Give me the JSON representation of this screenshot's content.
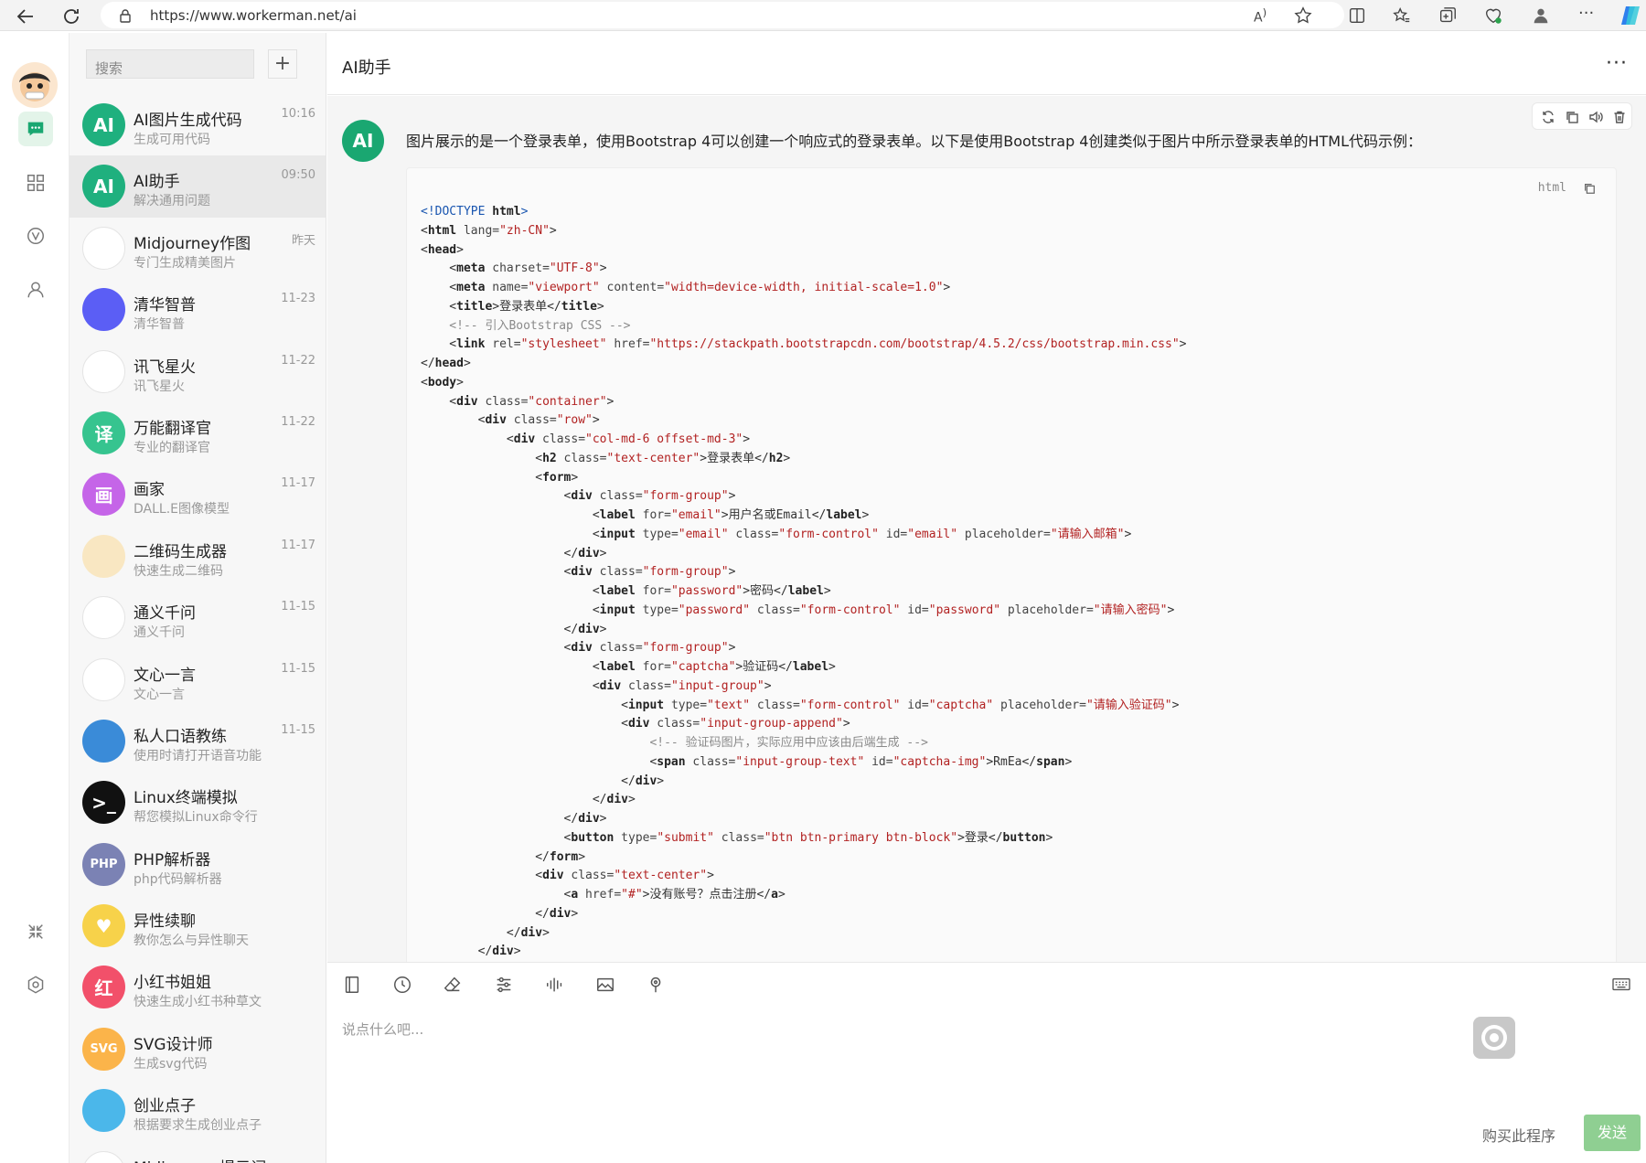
{
  "browser": {
    "url": "https://www.workerman.net/ai"
  },
  "sidebar": {
    "search_placeholder": "搜索",
    "add_label": "+",
    "items": [
      {
        "name": "AI图片生成代码",
        "desc": "生成可用代码",
        "time": "10:16",
        "icon": "AI",
        "color": "#1fb07e"
      },
      {
        "name": "AI助手",
        "desc": "解决通用问题",
        "time": "09:50",
        "icon": "AI",
        "color": "#1fb07e"
      },
      {
        "name": "Midjourney作图",
        "desc": "专门生成精美图片",
        "time": "昨天",
        "icon": "",
        "color": "#ffffff"
      },
      {
        "name": "清华智普",
        "desc": "清华智普",
        "time": "11-23",
        "icon": "",
        "color": "#5b5ef5"
      },
      {
        "name": "讯飞星火",
        "desc": "讯飞星火",
        "time": "11-22",
        "icon": "",
        "color": "#ffffff"
      },
      {
        "name": "万能翻译官",
        "desc": "专业的翻译官",
        "time": "11-22",
        "icon": "译",
        "color": "#36c48f"
      },
      {
        "name": "画家",
        "desc": "DALL.E图像模型",
        "time": "11-17",
        "icon": "画",
        "color": "#c565e8"
      },
      {
        "name": "二维码生成器",
        "desc": "快速生成二维码",
        "time": "11-17",
        "icon": "",
        "color": "#f9e7c2"
      },
      {
        "name": "通义千问",
        "desc": "通义千问",
        "time": "11-15",
        "icon": "",
        "color": "#ffffff"
      },
      {
        "name": "文心一言",
        "desc": "文心一言",
        "time": "11-15",
        "icon": "",
        "color": "#ffffff"
      },
      {
        "name": "私人口语教练",
        "desc": "使用时请打开语音功能",
        "time": "11-15",
        "icon": "",
        "color": "#3a8bd8"
      },
      {
        "name": "Linux终端模拟",
        "desc": "帮您模拟Linux命令行",
        "time": "",
        "icon": ">_",
        "color": "#111111"
      },
      {
        "name": "PHP解析器",
        "desc": "php代码解析器",
        "time": "",
        "icon": "PHP",
        "color": "#7b82b4"
      },
      {
        "name": "异性续聊",
        "desc": "教你怎么与异性聊天",
        "time": "",
        "icon": "♥",
        "color": "#f7d24a"
      },
      {
        "name": "小红书姐姐",
        "desc": "快速生成小红书种草文",
        "time": "",
        "icon": "红",
        "color": "#f2506a"
      },
      {
        "name": "SVG设计师",
        "desc": "生成svg代码",
        "time": "",
        "icon": "SVG",
        "color": "#fbb44a"
      },
      {
        "name": "创业点子",
        "desc": "根据要求生成创业点子",
        "time": "",
        "icon": "",
        "color": "#4bb7ea"
      },
      {
        "name": "Midjourney提示词",
        "desc": "",
        "time": "",
        "icon": "",
        "color": "#ffffff"
      }
    ]
  },
  "chat": {
    "title": "AI助手",
    "avatar_label": "AI",
    "message": "图片展示的是一个登录表单，使用Bootstrap 4可以创建一个响应式的登录表单。以下是使用Bootstrap 4创建类似于图片中所示登录表单的HTML代码示例：",
    "code_lang": "html",
    "code_lines": [
      [
        [
          "dt",
          "<!DOCTYPE "
        ],
        [
          "tn",
          "html"
        ],
        [
          "dt",
          ">"
        ]
      ],
      [
        [
          "t",
          "<"
        ],
        [
          "tn",
          "html"
        ],
        [
          "at",
          " lang="
        ],
        [
          "sv",
          "\"zh-CN\""
        ],
        [
          "t",
          ">"
        ]
      ],
      [
        [
          "t",
          "<"
        ],
        [
          "tn",
          "head"
        ],
        [
          "t",
          ">"
        ]
      ],
      [
        [
          "t",
          "    <"
        ],
        [
          "tn",
          "meta"
        ],
        [
          "at",
          " charset="
        ],
        [
          "sv",
          "\"UTF-8\""
        ],
        [
          "t",
          ">"
        ]
      ],
      [
        [
          "t",
          "    <"
        ],
        [
          "tn",
          "meta"
        ],
        [
          "at",
          " name="
        ],
        [
          "sv",
          "\"viewport\""
        ],
        [
          "at",
          " content="
        ],
        [
          "sv",
          "\"width=device-width, initial-scale=1.0\""
        ],
        [
          "t",
          ">"
        ]
      ],
      [
        [
          "t",
          "    <"
        ],
        [
          "tn",
          "title"
        ],
        [
          "t",
          ">登录表单</"
        ],
        [
          "tn",
          "title"
        ],
        [
          "t",
          ">"
        ]
      ],
      [
        [
          "cm",
          "    <!-- 引入Bootstrap CSS -->"
        ]
      ],
      [
        [
          "t",
          "    <"
        ],
        [
          "tn",
          "link"
        ],
        [
          "at",
          " rel="
        ],
        [
          "sv",
          "\"stylesheet\""
        ],
        [
          "at",
          " href="
        ],
        [
          "sv",
          "\"https://stackpath.bootstrapcdn.com/bootstrap/4.5.2/css/bootstrap.min.css\""
        ],
        [
          "t",
          ">"
        ]
      ],
      [
        [
          "t",
          "</"
        ],
        [
          "tn",
          "head"
        ],
        [
          "t",
          ">"
        ]
      ],
      [
        [
          "t",
          "<"
        ],
        [
          "tn",
          "body"
        ],
        [
          "t",
          ">"
        ]
      ],
      [
        [
          "t",
          "    <"
        ],
        [
          "tn",
          "div"
        ],
        [
          "at",
          " class="
        ],
        [
          "sv",
          "\"container\""
        ],
        [
          "t",
          ">"
        ]
      ],
      [
        [
          "t",
          "        <"
        ],
        [
          "tn",
          "div"
        ],
        [
          "at",
          " class="
        ],
        [
          "sv",
          "\"row\""
        ],
        [
          "t",
          ">"
        ]
      ],
      [
        [
          "t",
          "            <"
        ],
        [
          "tn",
          "div"
        ],
        [
          "at",
          " class="
        ],
        [
          "sv",
          "\"col-md-6 offset-md-3\""
        ],
        [
          "t",
          ">"
        ]
      ],
      [
        [
          "t",
          "                <"
        ],
        [
          "tn",
          "h2"
        ],
        [
          "at",
          " class="
        ],
        [
          "sv",
          "\"text-center\""
        ],
        [
          "t",
          ">登录表单</"
        ],
        [
          "tn",
          "h2"
        ],
        [
          "t",
          ">"
        ]
      ],
      [
        [
          "t",
          "                <"
        ],
        [
          "tn",
          "form"
        ],
        [
          "t",
          ">"
        ]
      ],
      [
        [
          "t",
          "                    <"
        ],
        [
          "tn",
          "div"
        ],
        [
          "at",
          " class="
        ],
        [
          "sv",
          "\"form-group\""
        ],
        [
          "t",
          ">"
        ]
      ],
      [
        [
          "t",
          "                        <"
        ],
        [
          "tn",
          "label"
        ],
        [
          "at",
          " for="
        ],
        [
          "sv",
          "\"email\""
        ],
        [
          "t",
          ">用户名或Email</"
        ],
        [
          "tn",
          "label"
        ],
        [
          "t",
          ">"
        ]
      ],
      [
        [
          "t",
          "                        <"
        ],
        [
          "tn",
          "input"
        ],
        [
          "at",
          " type="
        ],
        [
          "sv",
          "\"email\""
        ],
        [
          "at",
          " class="
        ],
        [
          "sv",
          "\"form-control\""
        ],
        [
          "at",
          " id="
        ],
        [
          "sv",
          "\"email\""
        ],
        [
          "at",
          " placeholder="
        ],
        [
          "sv",
          "\"请输入邮箱\""
        ],
        [
          "t",
          ">"
        ]
      ],
      [
        [
          "t",
          "                    </"
        ],
        [
          "tn",
          "div"
        ],
        [
          "t",
          ">"
        ]
      ],
      [
        [
          "t",
          "                    <"
        ],
        [
          "tn",
          "div"
        ],
        [
          "at",
          " class="
        ],
        [
          "sv",
          "\"form-group\""
        ],
        [
          "t",
          ">"
        ]
      ],
      [
        [
          "t",
          "                        <"
        ],
        [
          "tn",
          "label"
        ],
        [
          "at",
          " for="
        ],
        [
          "sv",
          "\"password\""
        ],
        [
          "t",
          ">密码</"
        ],
        [
          "tn",
          "label"
        ],
        [
          "t",
          ">"
        ]
      ],
      [
        [
          "t",
          "                        <"
        ],
        [
          "tn",
          "input"
        ],
        [
          "at",
          " type="
        ],
        [
          "sv",
          "\"password\""
        ],
        [
          "at",
          " class="
        ],
        [
          "sv",
          "\"form-control\""
        ],
        [
          "at",
          " id="
        ],
        [
          "sv",
          "\"password\""
        ],
        [
          "at",
          " placeholder="
        ],
        [
          "sv",
          "\"请输入密码\""
        ],
        [
          "t",
          ">"
        ]
      ],
      [
        [
          "t",
          "                    </"
        ],
        [
          "tn",
          "div"
        ],
        [
          "t",
          ">"
        ]
      ],
      [
        [
          "t",
          "                    <"
        ],
        [
          "tn",
          "div"
        ],
        [
          "at",
          " class="
        ],
        [
          "sv",
          "\"form-group\""
        ],
        [
          "t",
          ">"
        ]
      ],
      [
        [
          "t",
          "                        <"
        ],
        [
          "tn",
          "label"
        ],
        [
          "at",
          " for="
        ],
        [
          "sv",
          "\"captcha\""
        ],
        [
          "t",
          ">验证码</"
        ],
        [
          "tn",
          "label"
        ],
        [
          "t",
          ">"
        ]
      ],
      [
        [
          "t",
          "                        <"
        ],
        [
          "tn",
          "div"
        ],
        [
          "at",
          " class="
        ],
        [
          "sv",
          "\"input-group\""
        ],
        [
          "t",
          ">"
        ]
      ],
      [
        [
          "t",
          "                            <"
        ],
        [
          "tn",
          "input"
        ],
        [
          "at",
          " type="
        ],
        [
          "sv",
          "\"text\""
        ],
        [
          "at",
          " class="
        ],
        [
          "sv",
          "\"form-control\""
        ],
        [
          "at",
          " id="
        ],
        [
          "sv",
          "\"captcha\""
        ],
        [
          "at",
          " placeholder="
        ],
        [
          "sv",
          "\"请输入验证码\""
        ],
        [
          "t",
          ">"
        ]
      ],
      [
        [
          "t",
          "                            <"
        ],
        [
          "tn",
          "div"
        ],
        [
          "at",
          " class="
        ],
        [
          "sv",
          "\"input-group-append\""
        ],
        [
          "t",
          ">"
        ]
      ],
      [
        [
          "cm",
          "                                <!-- 验证码图片，实际应用中应该由后端生成 -->"
        ]
      ],
      [
        [
          "t",
          "                                <"
        ],
        [
          "tn",
          "span"
        ],
        [
          "at",
          " class="
        ],
        [
          "sv",
          "\"input-group-text\""
        ],
        [
          "at",
          " id="
        ],
        [
          "sv",
          "\"captcha-img\""
        ],
        [
          "t",
          ">RmEa</"
        ],
        [
          "tn",
          "span"
        ],
        [
          "t",
          ">"
        ]
      ],
      [
        [
          "t",
          "                            </"
        ],
        [
          "tn",
          "div"
        ],
        [
          "t",
          ">"
        ]
      ],
      [
        [
          "t",
          "                        </"
        ],
        [
          "tn",
          "div"
        ],
        [
          "t",
          ">"
        ]
      ],
      [
        [
          "t",
          "                    </"
        ],
        [
          "tn",
          "div"
        ],
        [
          "t",
          ">"
        ]
      ],
      [
        [
          "t",
          "                    <"
        ],
        [
          "tn",
          "button"
        ],
        [
          "at",
          " type="
        ],
        [
          "sv",
          "\"submit\""
        ],
        [
          "at",
          " class="
        ],
        [
          "sv",
          "\"btn btn-primary btn-block\""
        ],
        [
          "t",
          ">登录</"
        ],
        [
          "tn",
          "button"
        ],
        [
          "t",
          ">"
        ]
      ],
      [
        [
          "t",
          "                </"
        ],
        [
          "tn",
          "form"
        ],
        [
          "t",
          ">"
        ]
      ],
      [
        [
          "t",
          "                <"
        ],
        [
          "tn",
          "div"
        ],
        [
          "at",
          " class="
        ],
        [
          "sv",
          "\"text-center\""
        ],
        [
          "t",
          ">"
        ]
      ],
      [
        [
          "t",
          "                    <"
        ],
        [
          "tn",
          "a"
        ],
        [
          "at",
          " href="
        ],
        [
          "sv",
          "\"#\""
        ],
        [
          "t",
          ">没有账号？点击注册</"
        ],
        [
          "tn",
          "a"
        ],
        [
          "t",
          ">"
        ]
      ],
      [
        [
          "t",
          "                </"
        ],
        [
          "tn",
          "div"
        ],
        [
          "t",
          ">"
        ]
      ],
      [
        [
          "t",
          "            </"
        ],
        [
          "tn",
          "div"
        ],
        [
          "t",
          ">"
        ]
      ],
      [
        [
          "t",
          "        </"
        ],
        [
          "tn",
          "div"
        ],
        [
          "t",
          ">"
        ]
      ]
    ]
  },
  "composer": {
    "placeholder": "说点什么吧...",
    "buy_label": "购买此程序",
    "send_label": "发送"
  },
  "colors": {
    "accent": "#1aa771",
    "send": "#8fcf92"
  }
}
